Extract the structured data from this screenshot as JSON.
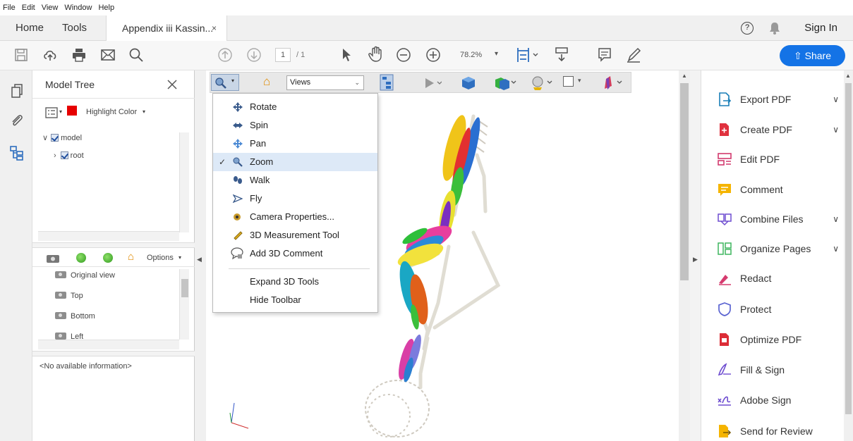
{
  "menubar": {
    "items": [
      "File",
      "Edit",
      "View",
      "Window",
      "Help"
    ]
  },
  "tabs": {
    "home": "Home",
    "tools": "Tools",
    "doc": "Appendix iii Kassin...",
    "close": "×"
  },
  "header": {
    "signin": "Sign In",
    "help": "?"
  },
  "toolbar": {
    "page_current": "1",
    "page_total": "/ 1",
    "zoom": "78.2%",
    "share": "Share"
  },
  "model_tree": {
    "title": "Model Tree",
    "highlight": "Highlight Color",
    "highlight_color": "#e60000",
    "nodes": [
      {
        "label": "model",
        "expand": "∨"
      },
      {
        "label": "root",
        "expand": "›"
      }
    ],
    "options_label": "Options",
    "views": [
      "Original view",
      "Top",
      "Bottom",
      "Left"
    ],
    "info": "<No available information>"
  },
  "toolbar_3d": {
    "views": "Views"
  },
  "dropdown": {
    "items": [
      {
        "label": "Rotate",
        "selected": false
      },
      {
        "label": "Spin",
        "selected": false
      },
      {
        "label": "Pan",
        "selected": false
      },
      {
        "label": "Zoom",
        "selected": true
      },
      {
        "label": "Walk",
        "selected": false
      },
      {
        "label": "Fly",
        "selected": false
      },
      {
        "label": "Camera Properties...",
        "selected": false
      },
      {
        "label": "3D Measurement Tool",
        "selected": false
      },
      {
        "label": "Add 3D Comment",
        "selected": false
      }
    ],
    "expand": "Expand 3D Tools",
    "hide": "Hide Toolbar",
    "check": "✓"
  },
  "tools_pane": {
    "items": [
      {
        "label": "Export PDF",
        "chev": "∨",
        "color": "#1a7fb7"
      },
      {
        "label": "Create PDF",
        "chev": "∨",
        "color": "#e0313e"
      },
      {
        "label": "Edit PDF",
        "chev": "",
        "color": "#d23a6e"
      },
      {
        "label": "Comment",
        "chev": "",
        "color": "#f5b400"
      },
      {
        "label": "Combine Files",
        "chev": "∨",
        "color": "#6e4dd0"
      },
      {
        "label": "Organize Pages",
        "chev": "∨",
        "color": "#3eb55f"
      },
      {
        "label": "Redact",
        "chev": "",
        "color": "#d53b6f"
      },
      {
        "label": "Protect",
        "chev": "",
        "color": "#5a63d1"
      },
      {
        "label": "Optimize PDF",
        "chev": "",
        "color": "#dc2d37"
      },
      {
        "label": "Fill & Sign",
        "chev": "",
        "color": "#6e4dd0"
      },
      {
        "label": "Adobe Sign",
        "chev": "",
        "color": "#6e4dd0"
      },
      {
        "label": "Send for Review",
        "chev": "",
        "color": "#f5b400"
      }
    ]
  }
}
